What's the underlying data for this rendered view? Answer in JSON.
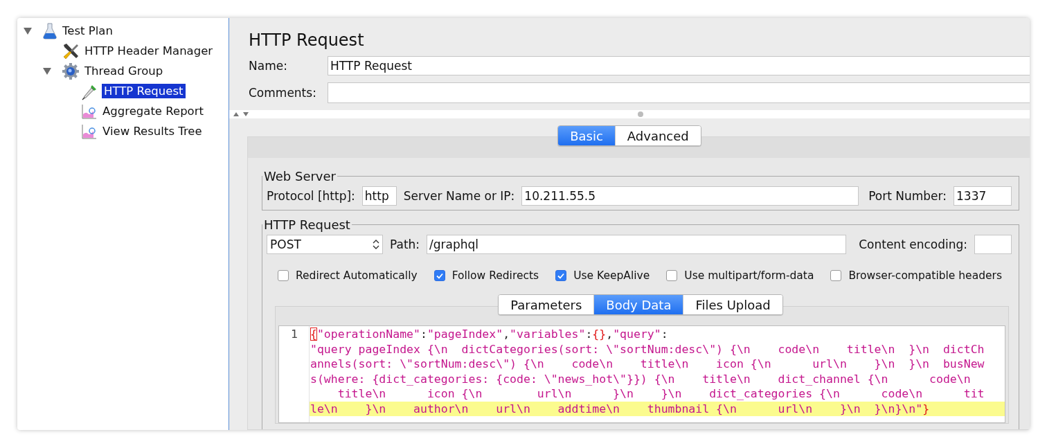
{
  "tree": [
    {
      "label": "Test Plan",
      "kind": "test_plan",
      "expanded": true,
      "selected": false,
      "children": [
        {
          "label": "HTTP Header Manager",
          "kind": "config",
          "selected": false
        },
        {
          "label": "Thread Group",
          "kind": "thread_group",
          "expanded": true,
          "selected": false,
          "children": [
            {
              "label": "HTTP Request",
              "kind": "sampler",
              "selected": true
            },
            {
              "label": "Aggregate Report",
              "kind": "listener",
              "selected": false
            },
            {
              "label": "View Results Tree",
              "kind": "listener",
              "selected": false
            }
          ]
        }
      ]
    }
  ],
  "editor": {
    "title": "HTTP Request",
    "name": {
      "label": "Name:",
      "value": "HTTP Request"
    },
    "comments": {
      "label": "Comments:"
    },
    "tabs": [
      {
        "label": "Basic",
        "selected": true
      },
      {
        "label": "Advanced",
        "selected": false
      }
    ],
    "web_server": {
      "legend": "Web Server",
      "protocol_label": "Protocol [http]:",
      "protocol": "http",
      "server_label": "Server Name or IP:",
      "server": "10.211.55.5",
      "port_label": "Port Number:",
      "port": "1337"
    },
    "http_request": {
      "legend": "HTTP Request",
      "method": "POST",
      "path_label": "Path:",
      "path": "/graphql",
      "encoding_label": "Content encoding:",
      "options": [
        {
          "label": "Redirect Automatically",
          "checked": false
        },
        {
          "label": "Follow Redirects",
          "checked": true
        },
        {
          "label": "Use KeepAlive",
          "checked": true
        },
        {
          "label": "Use multipart/form-data",
          "checked": false
        },
        {
          "label": "Browser-compatible headers",
          "checked": false
        }
      ],
      "body_tabs": [
        {
          "label": "Parameters",
          "selected": false
        },
        {
          "label": "Body Data",
          "selected": true
        },
        {
          "label": "Files Upload",
          "selected": false
        }
      ],
      "body": {
        "line_number": "1",
        "lines": [
          {
            "highlighted": false,
            "segments": [
              {
                "kind": "brace",
                "text": "{",
                "matched": true
              },
              {
                "kind": "string",
                "text": "\"operationName\""
              },
              {
                "kind": "punct",
                "text": ":"
              },
              {
                "kind": "string",
                "text": "\"pageIndex\""
              },
              {
                "kind": "punct",
                "text": ","
              },
              {
                "kind": "string",
                "text": "\"variables\""
              },
              {
                "kind": "punct",
                "text": ":"
              },
              {
                "kind": "brace",
                "text": "{}"
              },
              {
                "kind": "punct",
                "text": ","
              },
              {
                "kind": "string",
                "text": "\"query\""
              },
              {
                "kind": "punct",
                "text": ":"
              }
            ]
          },
          {
            "highlighted": false,
            "segments": [
              {
                "kind": "string",
                "text": "\"query pageIndex {\\n  dictCategories(sort: \\\"sortNum:desc\\\") {\\n    code\\n    title\\n  }\\n  dictCh"
              }
            ]
          },
          {
            "highlighted": false,
            "segments": [
              {
                "kind": "string",
                "text": "annels(sort: \\\"sortNum:desc\\\") {\\n    code\\n    title\\n    icon {\\n      url\\n    }\\n  }\\n  busNew"
              }
            ]
          },
          {
            "highlighted": false,
            "segments": [
              {
                "kind": "string",
                "text": "s(where: {dict_categories: {code: \\\"news_hot\\\"}}) {\\n    title\\n    dict_channel {\\n      code\\n"
              }
            ]
          },
          {
            "highlighted": false,
            "segments": [
              {
                "kind": "string",
                "text": "    title\\n      icon {\\n        url\\n      }\\n    }\\n    dict_categories {\\n      code\\n      tit"
              }
            ]
          },
          {
            "highlighted": true,
            "segments": [
              {
                "kind": "string",
                "text": "le\\n    }\\n    author\\n    url\\n    addtime\\n    thumbnail {\\n      url\\n    }\\n  }\\n}\\n\""
              },
              {
                "kind": "brace",
                "text": "}"
              }
            ]
          }
        ]
      }
    }
  }
}
